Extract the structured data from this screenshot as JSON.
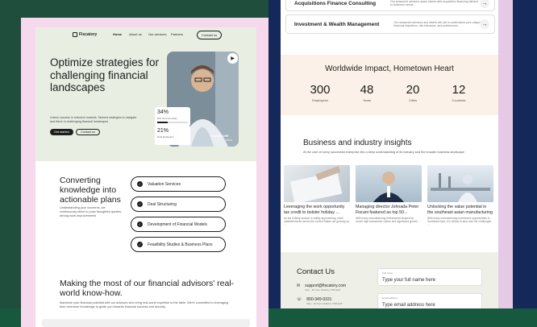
{
  "brand": {
    "name": "Fiscatory"
  },
  "nav": {
    "items": [
      "Home",
      "About us",
      "Our services",
      "Partners"
    ],
    "contact_btn": "Contact us"
  },
  "hero": {
    "title": "Optimize strategies for challenging financial landscapes",
    "subtitle": "Unlock success in turbulent markets. Tailored strategies to navigate and thrive in challenging financial landscapes",
    "primary_btn": "Get started",
    "secondary_btn": "Contact us",
    "metrics": [
      {
        "value": "34%",
        "label": "ROI Success Rate",
        "fill": 0.34
      },
      {
        "value": "21%",
        "label": "Debt Reduction",
        "fill": 0.21
      }
    ],
    "person_name": "David Lee",
    "person_role": "Financial Advisor"
  },
  "convert": {
    "title": "Converting knowledge into actionable plans",
    "subtitle": "Understanding your concerns, we continuously strive to pose thoughtful queries, driving work improvements",
    "items": [
      "Valuation Services",
      "Deal Structuring",
      "Development of Financial Models",
      "Feasibility Studies & Business Plans"
    ]
  },
  "make_most": {
    "title": "Making the most of our financial advisors' real-world know-how.",
    "subtitle": "Maximize your financial potential with our advisors who bring real-world expertise to the table. We're committed to leveraging their extensive knowledge to guide you towards financial success and security."
  },
  "services": [
    {
      "title": "Acquisitions Finance Consulting",
      "desc": "Our seasoned advisors assist clients with acquisition financing tailored to business needs"
    },
    {
      "title": "Investment & Wealth Management",
      "desc": "Our seasoned advisors and clients will use to understand your unique financial objectives, risk tolerance, and preferences."
    }
  ],
  "impact": {
    "title": "Worldwide Impact, Hometown Heart",
    "stats": [
      {
        "value": "300",
        "label": "Employees"
      },
      {
        "value": "48",
        "label": "Years"
      },
      {
        "value": "20",
        "label": "Cities"
      },
      {
        "value": "12",
        "label": "Countries"
      }
    ]
  },
  "insights": {
    "title": "Business and industry insights",
    "subtitle": "At the core of every successful enterprise lies a deep understanding of its industry and the broader business landscape",
    "cards": [
      {
        "title": "Leveraging the work opportunity tax credit to bolster holiday ...",
        "desc": "As the holiday season is swiftly approaching, retail establishments across the United States are gearing up ..."
      },
      {
        "title": "Managing director Johnada Peter Fisrani featured as top 50...",
        "desc": "With many manufacturing investments shaped by recent high transaction values and significant growth ..."
      },
      {
        "title": "Unlocking the value potential in the southeast asian manufacturing",
        "desc": "With many manufacturing investment opportunities in Southeast Asia, it is critical to also note the challenges ..."
      }
    ]
  },
  "contact": {
    "title": "Contact Us",
    "email": "support@fiscatory.com",
    "email_hours": "Mon - Fri from 10AM to 7PM EST",
    "phone": "800-349-9331",
    "phone_hours": "Mon - Fri from 10AM to 7PM EST",
    "name_label": "Full name",
    "name_placeholder": "Type your full name here",
    "email_label": "Email address",
    "email_placeholder": "Type email address here"
  },
  "icons": {
    "check": "check-icon",
    "arrow": "arrow-right-icon",
    "play": "play-icon",
    "mail": "mail-icon",
    "phone": "phone-icon"
  }
}
